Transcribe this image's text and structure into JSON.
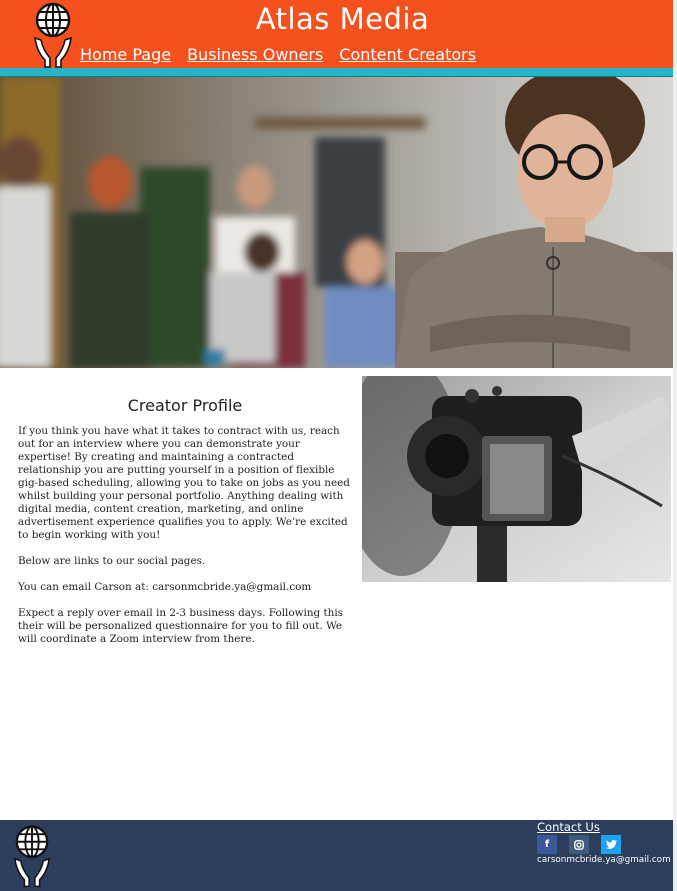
{
  "header": {
    "title": "Atlas Media",
    "nav": [
      "Home Page",
      "Business Owners",
      "Content Creators"
    ],
    "logo_icon": "globe-hands-logo-icon",
    "colors": {
      "bar": "#f4511e",
      "strip": "#25b5c9"
    }
  },
  "hero": {
    "image": "team-office-photo",
    "colors": {
      "tone": "#7d7468"
    }
  },
  "main": {
    "title": "Creator Profile",
    "paragraphs": [
      "If you think you have what it takes to contract with us, reach out for an interview where you can demonstrate your expertise! By creating and maintaining a contracted relationship you are putting yourself in a position of flexible gig-based scheduling, allowing you to take on jobs as you need whilst building your personal portfolio. Anything dealing with digital media, content creation, marketing, and online advertisement experience qualifies you to apply. We’re excited to begin working with you!",
      "Below are links to our social pages.",
      "You can email Carson at: carsonmcbride.ya@gmail.com",
      "Expect a reply over email in 2-3 business days. Following this their will be personalized questionnaire for you to fill out. We will coordinate a Zoom interview from there."
    ],
    "side_image": "camera-photo"
  },
  "footer": {
    "contact_label": "Contact Us",
    "email": "carsonmcbride.ya@gmail.com",
    "social": [
      {
        "icon": "facebook-icon",
        "glyph": "f",
        "color": "#3b5998"
      },
      {
        "icon": "instagram-icon",
        "glyph": "◘",
        "color": "#3f5a7a"
      },
      {
        "icon": "twitter-icon",
        "glyph": "🐦",
        "color": "#1da1f2"
      }
    ],
    "colors": {
      "background": "#2c3e5c"
    }
  }
}
